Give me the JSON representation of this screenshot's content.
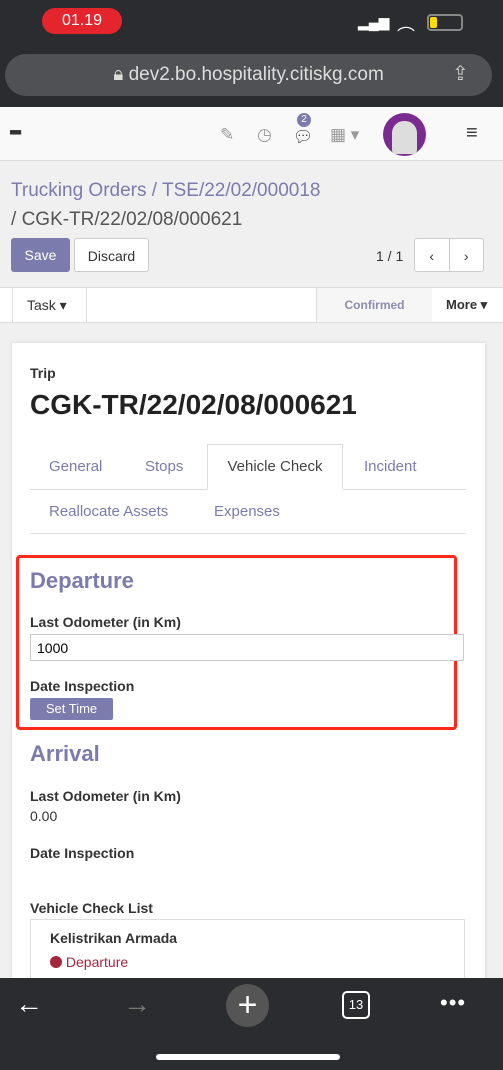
{
  "status_bar": {
    "time": "01.19"
  },
  "browser": {
    "url": "dev2.bo.hospitality.citiskg.com",
    "tabs_count": "13"
  },
  "navbar": {
    "message_badge": "2"
  },
  "breadcrumb": {
    "items": [
      "Trucking Orders",
      "TSE/22/02/000018"
    ],
    "current": "CGK-TR/22/02/08/000621"
  },
  "buttons": {
    "save": "Save",
    "discard": "Discard",
    "pager": "1 / 1",
    "task": "Task",
    "more": "More"
  },
  "status": {
    "stage": "Confirmed"
  },
  "form": {
    "trip_label": "Trip",
    "trip_name": "CGK-TR/22/02/08/000621",
    "tabs": [
      "General",
      "Stops",
      "Vehicle Check",
      "Incident",
      "Reallocate Assets",
      "Expenses"
    ],
    "active_tab": "Vehicle Check",
    "departure": {
      "title": "Departure",
      "odometer_label": "Last Odometer (in Km)",
      "odometer_value": "1000",
      "date_label": "Date Inspection",
      "set_time": "Set Time"
    },
    "arrival": {
      "title": "Arrival",
      "odometer_label": "Last Odometer (in Km)",
      "odometer_value": "0.00",
      "date_label": "Date Inspection"
    },
    "checklist": {
      "label": "Vehicle Check List",
      "item_title": "Kelistrikan Armada",
      "item_status": "Departure",
      "status_color": "#a3283f"
    }
  },
  "highlight_color": "#ff2a1a"
}
